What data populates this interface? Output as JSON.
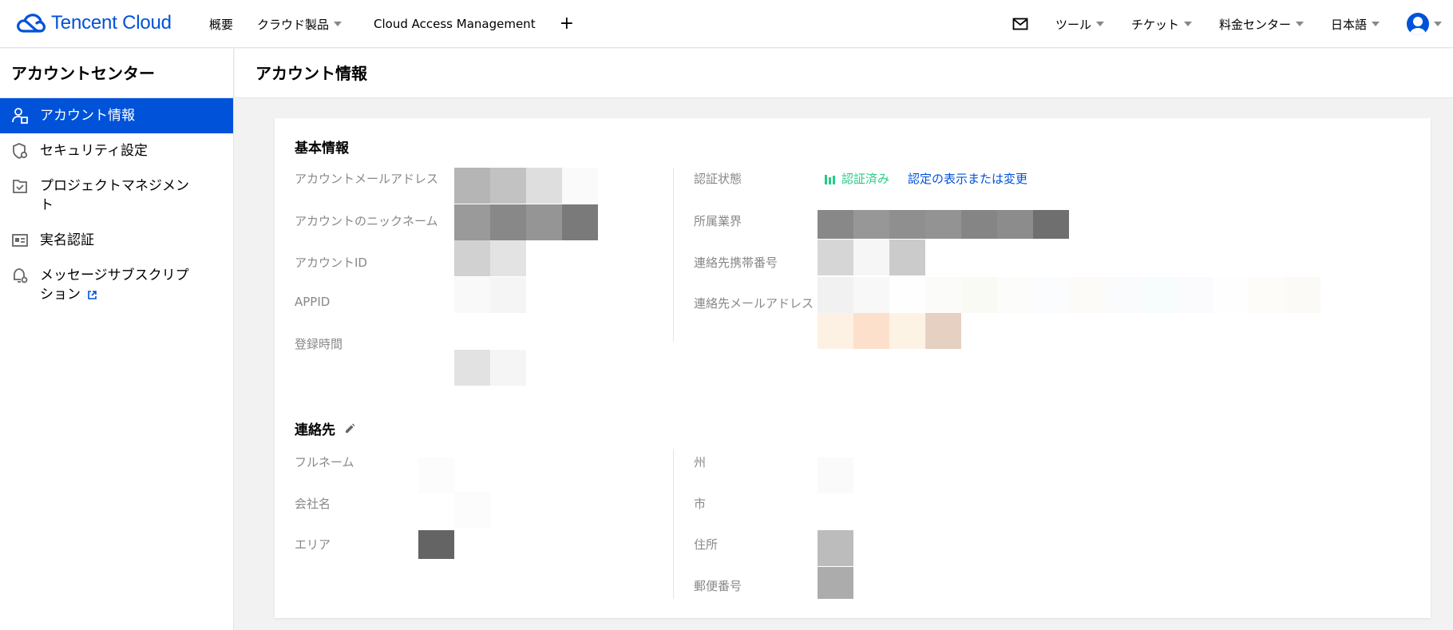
{
  "brand": {
    "name": "Tencent Cloud",
    "color": "#0052d9"
  },
  "topnav": {
    "items": [
      {
        "label": "概要",
        "dropdown": false
      },
      {
        "label": "クラウド製品",
        "dropdown": true
      },
      {
        "label": "Cloud Access Management",
        "dropdown": false
      }
    ],
    "add_label": "+",
    "right_items": [
      {
        "label": "ツール",
        "dropdown": true
      },
      {
        "label": "チケット",
        "dropdown": true
      },
      {
        "label": "料金センター",
        "dropdown": true
      },
      {
        "label": "日本語",
        "dropdown": true
      }
    ],
    "mail_icon": "mail-icon",
    "avatar_icon": "user-avatar-icon"
  },
  "sidebar": {
    "title": "アカウントセンター",
    "items": [
      {
        "label": "アカウント情報",
        "icon": "user-card-icon",
        "active": true
      },
      {
        "label": "セキュリティ設定",
        "icon": "shield-gear-icon",
        "active": false
      },
      {
        "label": "プロジェクトマネジメント",
        "icon": "folder-check-icon",
        "active": false
      },
      {
        "label": "実名認証",
        "icon": "id-card-icon",
        "active": false
      },
      {
        "label": "メッセージサブスクリプション",
        "icon": "bell-gear-icon",
        "active": false,
        "external": true
      }
    ]
  },
  "page": {
    "title": "アカウント情報"
  },
  "basic_info": {
    "title": "基本情報",
    "left_labels": [
      "アカウントメールアドレス",
      "アカウントのニックネーム",
      "アカウントID",
      "APPID",
      "登録時間"
    ],
    "right_labels": [
      "認証状態",
      "所属業界",
      "連絡先携帯番号",
      "連絡先メールアドレス"
    ],
    "verification_status": "認証済み",
    "verification_link": "認定の表示または変更",
    "status_color": "#29cc85"
  },
  "contact": {
    "title": "連絡先",
    "left_labels": [
      "フルネーム",
      "会社名",
      "エリア"
    ],
    "right_labels": [
      "州",
      "市",
      "住所",
      "郵便番号"
    ]
  }
}
